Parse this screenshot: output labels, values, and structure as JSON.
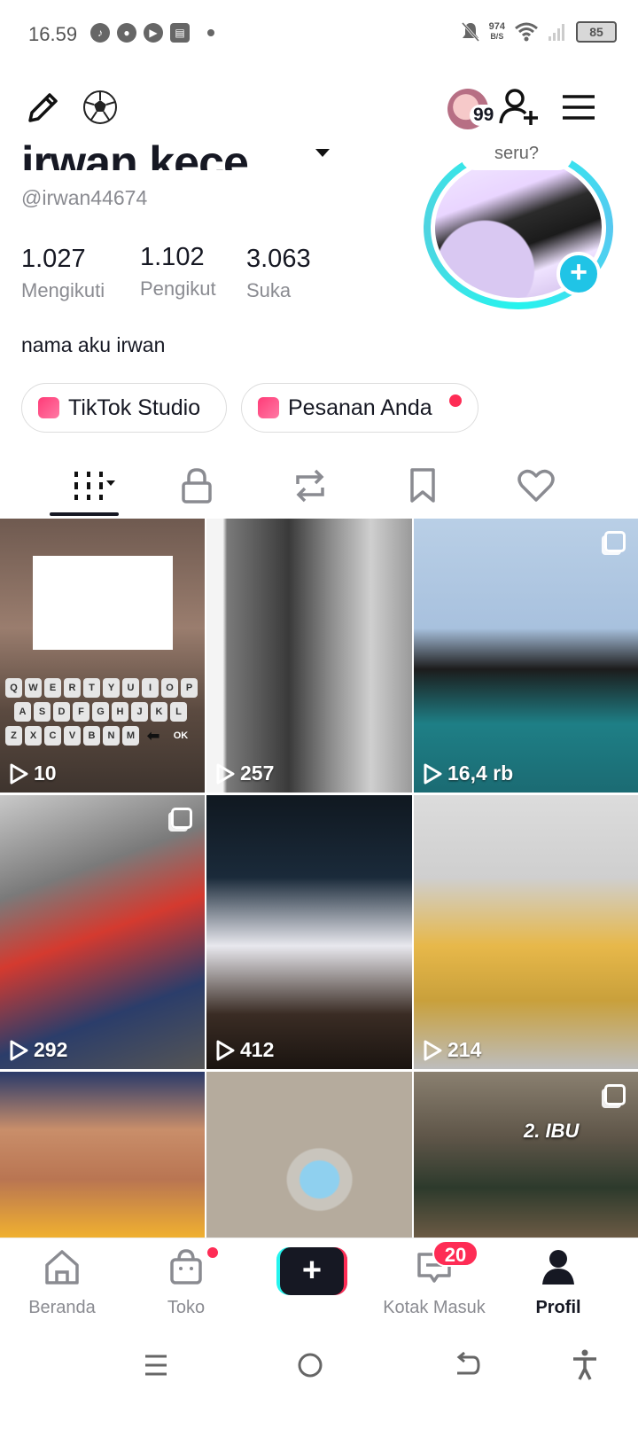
{
  "status_bar": {
    "time": "16.59",
    "net_speed": "974",
    "net_unit": "B/S",
    "battery": "85"
  },
  "header": {
    "friends_badge": "99"
  },
  "profile": {
    "name": "irwan kece",
    "handle": "@irwan44674",
    "avatar_bubble": "seru?",
    "bio": "nama aku irwan",
    "stats": [
      {
        "value": "1.027",
        "label": "Mengikuti"
      },
      {
        "value": "1.102",
        "label": "Pengikut"
      },
      {
        "value": "3.063",
        "label": "Suka"
      }
    ],
    "buttons": {
      "studio": "TikTok Studio",
      "orders": "Pesanan Anda"
    }
  },
  "keyboard_rows": [
    [
      "Q",
      "W",
      "E",
      "R",
      "T",
      "Y",
      "U",
      "I",
      "O",
      "P"
    ],
    [
      "A",
      "S",
      "D",
      "F",
      "G",
      "H",
      "J",
      "K",
      "L"
    ],
    [
      "Z",
      "X",
      "C",
      "V",
      "B",
      "N",
      "M",
      "⬅",
      "OK"
    ]
  ],
  "videos": [
    {
      "views": "10"
    },
    {
      "views": "257"
    },
    {
      "views": "16,4 rb"
    },
    {
      "views": "292"
    },
    {
      "views": "412"
    },
    {
      "views": "214"
    },
    {
      "views": ""
    },
    {
      "views": ""
    },
    {
      "views": "",
      "overlay_text": "2. IBU"
    }
  ],
  "bottom_nav": {
    "home": "Beranda",
    "shop": "Toko",
    "inbox": "Kotak Masuk",
    "inbox_badge": "20",
    "profile": "Profil"
  }
}
